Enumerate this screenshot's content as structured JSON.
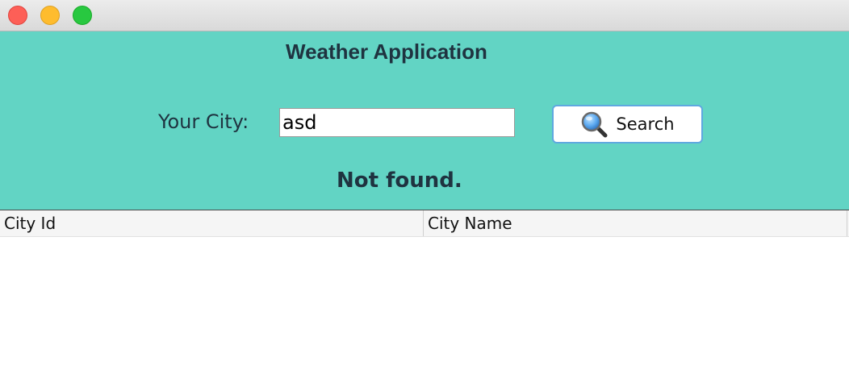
{
  "window": {
    "controls": [
      "close",
      "minimize",
      "zoom"
    ]
  },
  "header": {
    "title": "Weather Application",
    "background_color": "#62d4c4"
  },
  "search": {
    "label": "Your City:",
    "value": "asd",
    "button_label": "Search",
    "button_icon": "magnifier-icon"
  },
  "status": {
    "message": "Not found."
  },
  "table": {
    "columns": [
      "City Id",
      "City Name"
    ],
    "rows": []
  }
}
